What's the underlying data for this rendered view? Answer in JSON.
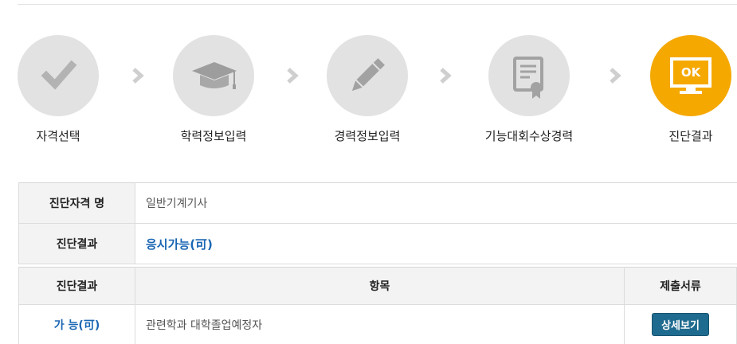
{
  "steps": [
    {
      "label": "자격선택",
      "icon": "check-icon",
      "active": false
    },
    {
      "label": "학력정보입력",
      "icon": "graduation-cap-icon",
      "active": false
    },
    {
      "label": "경력정보입력",
      "icon": "pencil-icon",
      "active": false
    },
    {
      "label": "기능대회수상경력",
      "icon": "certificate-icon",
      "active": false
    },
    {
      "label": "진단결과",
      "icon": "ok-monitor-icon",
      "active": true
    }
  ],
  "icon_text": {
    "ok": "OK"
  },
  "colors": {
    "inactive_circle": "#e2e2e2",
    "active_circle": "#f5a800",
    "link_blue": "#1a66b3",
    "button": "#1f6b8f"
  },
  "info": {
    "qualification_label": "진단자격 명",
    "qualification_value": "일반기계기사",
    "result_label": "진단결과",
    "result_value": "응시가능(可)"
  },
  "results_table": {
    "headers": [
      "진단결과",
      "항목",
      "제출서류"
    ],
    "rows": [
      {
        "result": "가 능(可)",
        "item": "관련학과 대학졸업예정자",
        "button": "상세보기"
      }
    ]
  }
}
